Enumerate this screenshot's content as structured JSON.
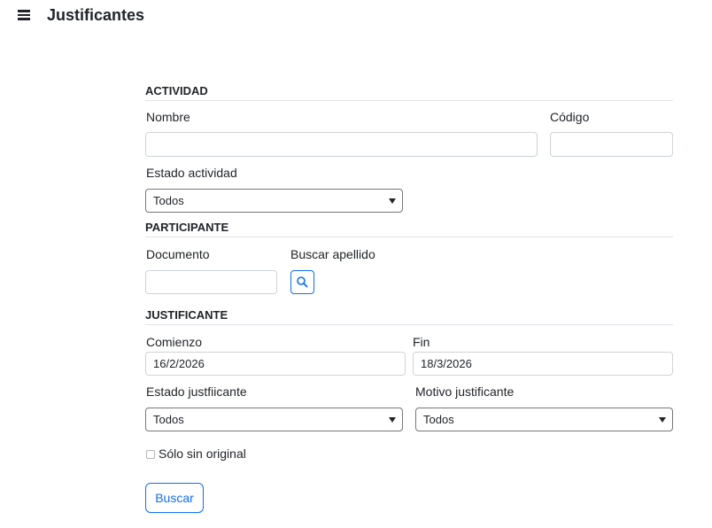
{
  "header": {
    "title": "Justificantes",
    "menu_icon": "hamburger-menu-icon"
  },
  "actividad": {
    "heading": "ACTIVIDAD",
    "nombre_label": "Nombre",
    "nombre_value": "",
    "codigo_label": "Código",
    "codigo_value": "",
    "estado_label": "Estado actividad",
    "estado_value": "Todos"
  },
  "participante": {
    "heading": "PARTICIPANTE",
    "documento_label": "Documento",
    "documento_value": "",
    "buscar_apellido_label": "Buscar apellido",
    "search_icon": "magnifier-icon"
  },
  "justificante": {
    "heading": "JUSTIFICANTE",
    "comienzo_label": "Comienzo",
    "comienzo_value": "16/2/2026",
    "fin_label": "Fin",
    "fin_value": "18/3/2026",
    "estado_label": "Estado justfiicante",
    "estado_value": "Todos",
    "motivo_label": "Motivo justificante",
    "motivo_value": "Todos",
    "solo_sin_original_label": "Sólo sin original",
    "solo_sin_original_checked": false
  },
  "actions": {
    "buscar_label": "Buscar"
  },
  "colors": {
    "accent": "#0d6efd",
    "text": "#212529",
    "border": "#ced4da"
  }
}
